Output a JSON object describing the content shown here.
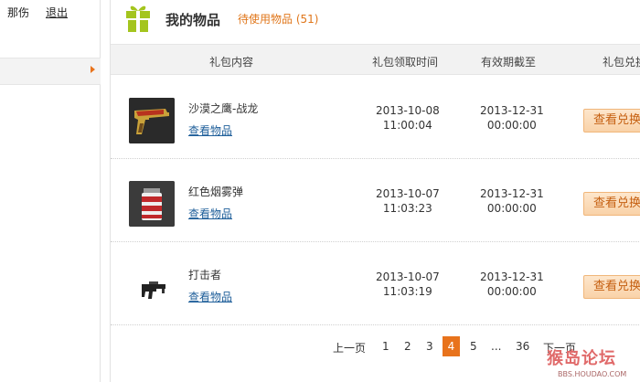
{
  "sidebar": {
    "username": "那伤",
    "logout_label": "退出"
  },
  "header": {
    "title": "我的物品",
    "pending_label": "待使用物品 (51)"
  },
  "table": {
    "columns": [
      "礼包内容",
      "礼包领取时间",
      "有效期截至",
      "礼包兑换"
    ],
    "view_link_label": "查看物品",
    "redeem_label": "查看兑换",
    "rows": [
      {
        "name": "沙漠之鹰-战龙",
        "received_date": "2013-10-08",
        "received_time": "11:00:04",
        "expiry_date": "2013-12-31",
        "expiry_time": "00:00:00",
        "icon": "desert-eagle-pistol-icon"
      },
      {
        "name": "红色烟雾弹",
        "received_date": "2013-10-07",
        "received_time": "11:03:23",
        "expiry_date": "2013-12-31",
        "expiry_time": "00:00:00",
        "icon": "red-smoke-grenade-icon"
      },
      {
        "name": "打击者",
        "received_date": "2013-10-07",
        "received_time": "11:03:19",
        "expiry_date": "2013-12-31",
        "expiry_time": "00:00:00",
        "icon": "striker-gun-icon"
      }
    ]
  },
  "pagination": {
    "prev_label": "上一页",
    "pages": [
      "1",
      "2",
      "3",
      "4",
      "5",
      "...",
      "36"
    ],
    "current_page": "4",
    "next_label": "下一页"
  },
  "watermark": {
    "title": "猴岛论坛",
    "url": "BBS.HOUDAO.COM"
  },
  "colors": {
    "accent": "#e8731c",
    "link": "#1f5f9a",
    "gift_icon": "#a4c51e"
  }
}
